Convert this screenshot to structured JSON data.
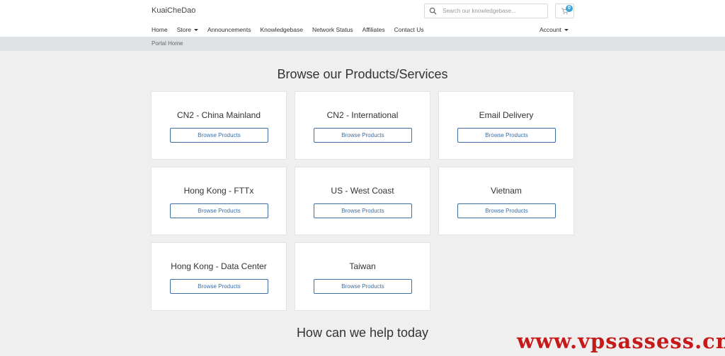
{
  "header": {
    "logo": "KuaiCheDao",
    "search_placeholder": "Search our knowledgebase...",
    "cart_count": "0"
  },
  "nav": {
    "items": [
      "Home",
      "Store",
      "Announcements",
      "Knowledgebase",
      "Network Status",
      "Affiliates",
      "Contact Us"
    ],
    "account": "Account"
  },
  "breadcrumb": "Portal Home",
  "main": {
    "heading": "Browse our Products/Services",
    "help_heading": "How can we help today",
    "button_label": "Browse Products",
    "categories": [
      "CN2 - China Mainland",
      "CN2 - International",
      "Email Delivery",
      "Hong Kong - FTTx",
      "US - West Coast",
      "Vietnam",
      "Hong Kong - Data Center",
      "Taiwan"
    ]
  },
  "watermark": "www.vpsassess.cn",
  "colors": {
    "accent": "#3e6ea3",
    "badge": "#3aa5d6",
    "watermark": "#c61a1a"
  }
}
